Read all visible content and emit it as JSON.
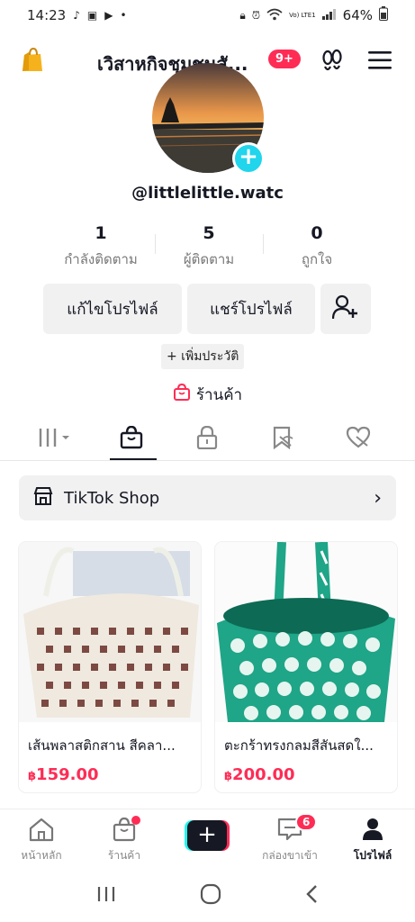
{
  "status_bar": {
    "time": "14:23",
    "battery": "64%",
    "network": "Vo) LTE1"
  },
  "header": {
    "title": "เวิสาหกิจชุมชนสั...",
    "notification_count": "9+"
  },
  "profile": {
    "username": "@littlelittle.watc",
    "stats": [
      {
        "value": "1",
        "label": "กำลังติดตาม"
      },
      {
        "value": "5",
        "label": "ผู้ติดตาม"
      },
      {
        "value": "0",
        "label": "ถูกใจ"
      }
    ],
    "edit_label": "แก้ไขโปรไฟล์",
    "share_label": "แชร์โปรไฟล์",
    "add_bio_label": "+ เพิ่มประวัติ",
    "shop_label": "ร้านค้า"
  },
  "tiktok_shop": {
    "label": "TikTok Shop"
  },
  "products": [
    {
      "title": "เส้นพลาสติกสาน สีคลา...",
      "currency": "฿",
      "price": "159.00"
    },
    {
      "title": "ตะกร้าทรงกลมสีสันสดใ...",
      "currency": "฿",
      "price": "200.00"
    }
  ],
  "bottom_nav": {
    "home": "หน้าหลัก",
    "shop": "ร้านค้า",
    "inbox": "กล่องขาเข้า",
    "inbox_count": "6",
    "profile": "โปรไฟล์"
  },
  "colors": {
    "accent": "#fe2c55",
    "cyan": "#20d5ec",
    "text": "#161823"
  }
}
